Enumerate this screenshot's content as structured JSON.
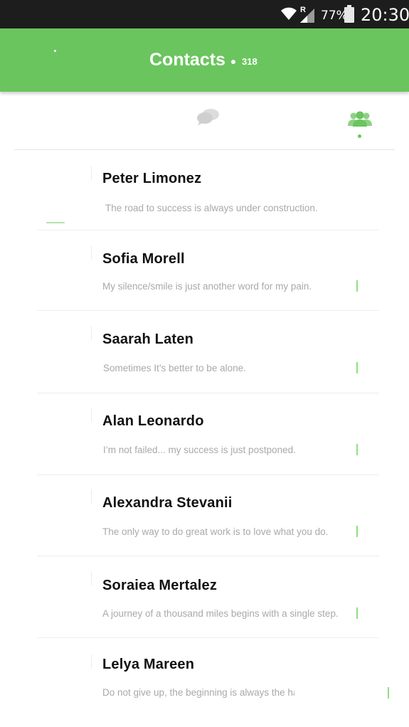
{
  "status_bar": {
    "signal_label": "R",
    "battery": "77%",
    "time": "20:30"
  },
  "app_bar": {
    "title": "Contacts",
    "count": "318"
  },
  "tabs": [
    {
      "icon": "chat-bubbles-icon",
      "active": false
    },
    {
      "icon": "group-icon",
      "active": true
    }
  ],
  "contacts": [
    {
      "name": "Peter Limonez",
      "status": "The road to success is always under construction."
    },
    {
      "name": "Sofia Morell",
      "status": "My silence/smile is just another word for my pain."
    },
    {
      "name": "Saarah Laten",
      "status": "Sometimes It’s better to be alone."
    },
    {
      "name": "Alan Leonardo",
      "status": "I’m not failed... my success is just postponed."
    },
    {
      "name": "Alexandra Stevanii",
      "status": "The only way to do great work is to love what you do."
    },
    {
      "name": "Soraiea Mertalez",
      "status": "A journey of a thousand miles begins with a single step."
    },
    {
      "name": "Lelya Mareen",
      "status": "Do not give up, the beginning is always the ha"
    }
  ],
  "colors": {
    "accent": "#6ac55e",
    "status_bar": "#1d1d1d",
    "name_text": "#111111",
    "status_text": "#a9a9a9"
  }
}
